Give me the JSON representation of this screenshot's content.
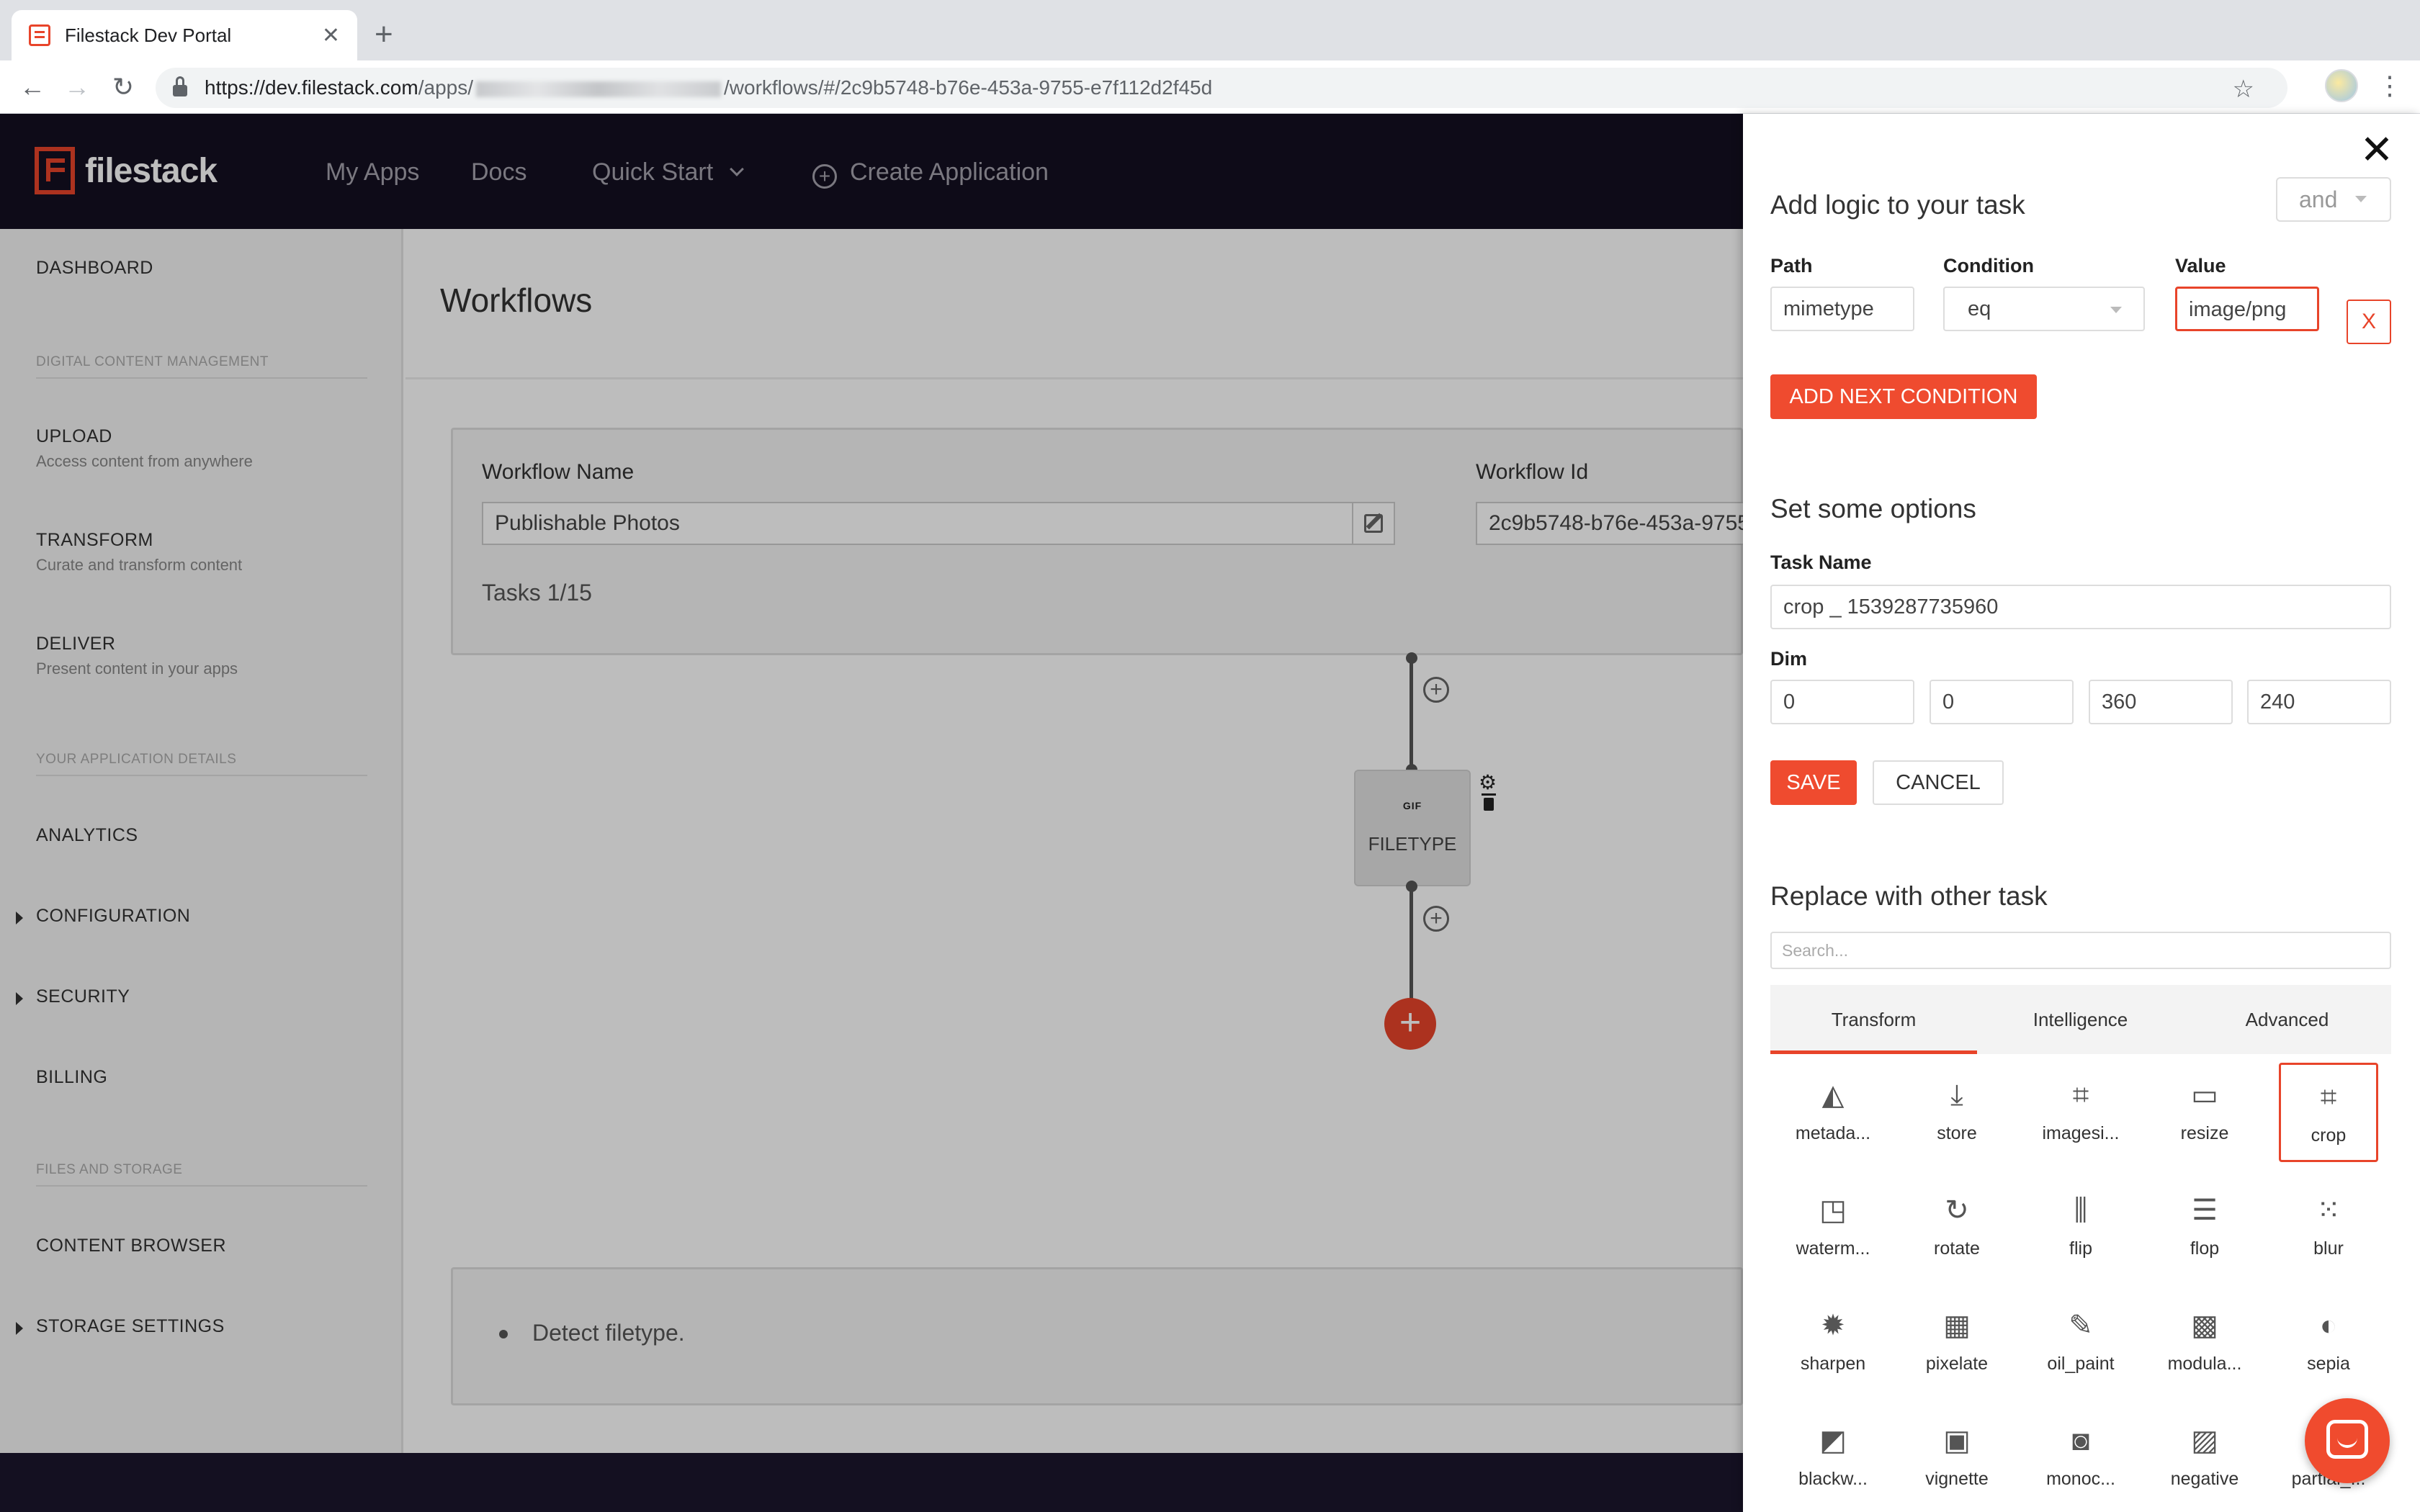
{
  "browser": {
    "tab_title": "Filestack Dev Portal",
    "url_prefix": "https://dev.filestack.com",
    "url_mid": "/apps/",
    "url_suffix": "/workflows/#/2c9b5748-b76e-453a-9755-e7f112d2f45d"
  },
  "header": {
    "logo_text": "filestack",
    "nav": [
      "My Apps",
      "Docs",
      "Quick Start",
      "Create Application"
    ]
  },
  "sidebar": {
    "dashboard": "DASHBOARD",
    "section_dcm": "DIGITAL CONTENT MANAGEMENT",
    "upload": "UPLOAD",
    "upload_sub": "Access content from anywhere",
    "transform": "TRANSFORM",
    "transform_sub": "Curate and transform content",
    "deliver": "DELIVER",
    "deliver_sub": "Present content in your apps",
    "section_app": "YOUR APPLICATION DETAILS",
    "analytics": "ANALYTICS",
    "configuration": "CONFIGURATION",
    "security": "SECURITY",
    "billing": "BILLING",
    "section_files": "FILES AND STORAGE",
    "content_browser": "CONTENT BROWSER",
    "storage_settings": "STORAGE SETTINGS"
  },
  "main": {
    "title": "Workflows",
    "workflow_name_label": "Workflow Name",
    "workflow_name_value": "Publishable Photos",
    "workflow_id_label": "Workflow Id",
    "workflow_id_value": "2c9b5748-b76e-453a-9755-e7f112d2f45d",
    "tasks_count": "Tasks 1/15",
    "task_node_icon": "GIF",
    "task_node_label": "FILETYPE",
    "description": "Detect filetype."
  },
  "panel": {
    "logic_heading": "Add logic to your task",
    "logic_operator": "and",
    "path_label": "Path",
    "condition_label": "Condition",
    "value_label": "Value",
    "path_value": "mimetype",
    "condition_value": "eq",
    "value_value": "image/png",
    "remove_label": "X",
    "add_condition": "ADD NEXT CONDITION",
    "options_heading": "Set some options",
    "task_name_label": "Task Name",
    "task_name_value": "crop _ 1539287735960",
    "dim_label": "Dim",
    "dim": [
      "0",
      "0",
      "360",
      "240"
    ],
    "save": "SAVE",
    "cancel": "CANCEL",
    "replace_heading": "Replace with other task",
    "search_placeholder": "Search...",
    "tabs": [
      "Transform",
      "Intelligence",
      "Advanced"
    ],
    "tiles": [
      {
        "label": "metada...",
        "icon": "metadata-icon"
      },
      {
        "label": "store",
        "icon": "download-icon"
      },
      {
        "label": "imagesi...",
        "icon": "crop-icon"
      },
      {
        "label": "resize",
        "icon": "resize-icon"
      },
      {
        "label": "crop",
        "icon": "crop-icon"
      },
      {
        "label": "waterm...",
        "icon": "watermark-icon"
      },
      {
        "label": "rotate",
        "icon": "rotate-icon"
      },
      {
        "label": "flip",
        "icon": "flip-icon"
      },
      {
        "label": "flop",
        "icon": "flop-icon"
      },
      {
        "label": "blur",
        "icon": "blur-icon"
      },
      {
        "label": "sharpen",
        "icon": "sharpen-icon"
      },
      {
        "label": "pixelate",
        "icon": "pixelate-icon"
      },
      {
        "label": "oil_paint",
        "icon": "brush-icon"
      },
      {
        "label": "modula...",
        "icon": "grid-icon"
      },
      {
        "label": "sepia",
        "icon": "contrast-icon"
      },
      {
        "label": "blackw...",
        "icon": "bw-icon"
      },
      {
        "label": "vignette",
        "icon": "vignette-icon"
      },
      {
        "label": "monoc...",
        "icon": "camera-icon"
      },
      {
        "label": "negative",
        "icon": "image-icon"
      },
      {
        "label": "partial_...",
        "icon": "partial-icon"
      }
    ]
  },
  "colors": {
    "accent": "#e8442a",
    "header_bg": "#141021"
  }
}
